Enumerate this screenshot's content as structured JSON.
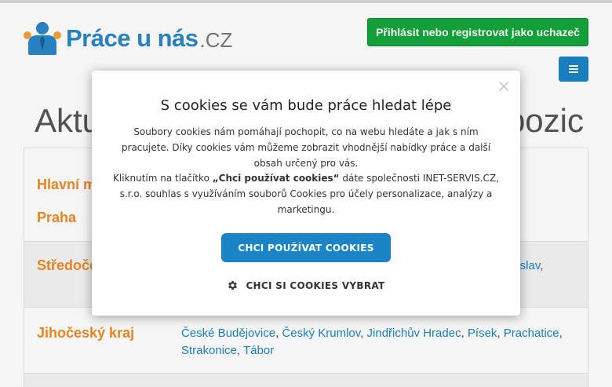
{
  "header": {
    "logo_text": "Práce u nás",
    "logo_tld": ".CZ",
    "login_button": "Přihlásit nebo registrovat jako uchazeč",
    "menu_icon": "hamburger-icon"
  },
  "heading": {
    "left_text": "Aktu",
    "right_text": "pozic"
  },
  "regions": [
    {
      "name_line1": "Hlavní m",
      "name_line2": "Praha",
      "cities_visible": []
    },
    {
      "name": "Středoče",
      "cities_tail": "leslav",
      "cities_tail_comma": ","
    },
    {
      "name": "Jihočeský kraj",
      "cities": [
        "České Budějovice",
        "Český Krumlov",
        "Jindřichův Hradec",
        "Písek",
        "Prachatice",
        "Strakonice",
        "Tábor"
      ]
    }
  ],
  "cookie_modal": {
    "close_symbol": "×",
    "title": "S cookies se vám bude práce hledat lépe",
    "paragraph1": "Soubory cookies nám pomáhají pochopit, co na webu hledáte a jak s ním pracujete. Díky cookies vám můžeme zobrazit vhodnější nabídky práce a další obsah určený pro vás.",
    "paragraph2_prefix": "Kliknutím na tlačítko ",
    "paragraph2_bold": "„Chci používat cookies“",
    "paragraph2_suffix": " dáte společnosti INET-SERVIS.CZ, s.r.o. souhlas s využíváním souborů Cookies pro účely personalizace, analýzy a marketingu.",
    "accept_button": "CHCI POUŽÍVAT COOKIES",
    "choose_button": "CHCI SI COOKIES VYBRAT",
    "choose_icon": "gear-icon"
  },
  "colors": {
    "brand_blue": "#1b84c6",
    "green_button": "#14a63a",
    "region_orange": "#f08a24"
  }
}
